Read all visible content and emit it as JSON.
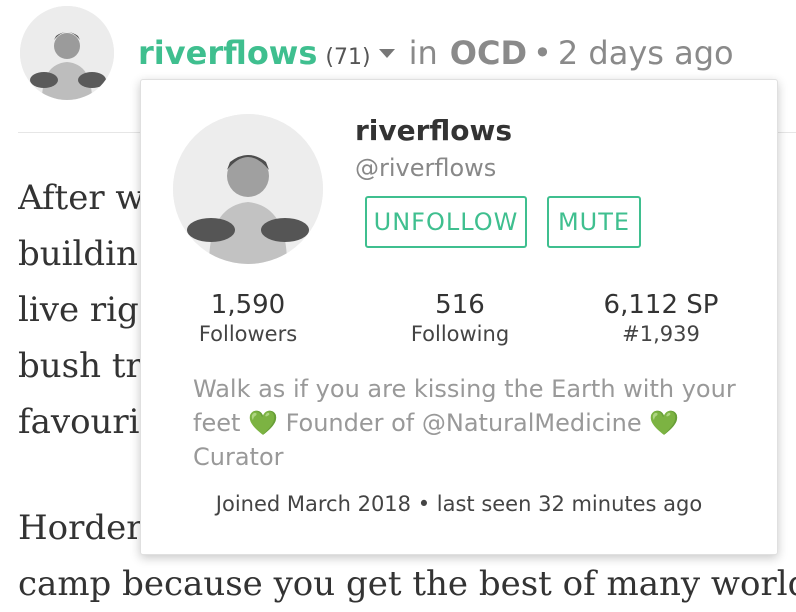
{
  "post": {
    "author": "riverflows",
    "reputation": "(71)",
    "in_label": "in",
    "category": "OCD",
    "separator": "•",
    "age": "2 days ago"
  },
  "article": {
    "lines": [
      "After w                                                                              i",
      "buildin                                                                              n",
      "live rig                                                                             so",
      "bush tr                                                                              ic",
      "favouri"
    ],
    "line2_start": "Horder                                                                            Ba",
    "line3_start": "camp because you get the best of many worlds"
  },
  "profile_card": {
    "name": "riverflows",
    "handle": "@riverflows",
    "unfollow_label": "UNFOLLOW",
    "mute_label": "MUTE",
    "stats": [
      {
        "value": "1,590",
        "label": "Followers"
      },
      {
        "value": "516",
        "label": "Following"
      },
      {
        "value": "6,112 SP",
        "label": "#1,939"
      }
    ],
    "about_part1": "Walk as if you are kissing the Earth with your feet",
    "heart": "💚",
    "about_part2": "Founder of @NaturalMedicine",
    "about_part3": "Curator",
    "joined": "Joined March 2018 • last seen 32 minutes ago"
  },
  "colors": {
    "accent": "#3fbf8f",
    "muted": "#8a8a8a"
  }
}
